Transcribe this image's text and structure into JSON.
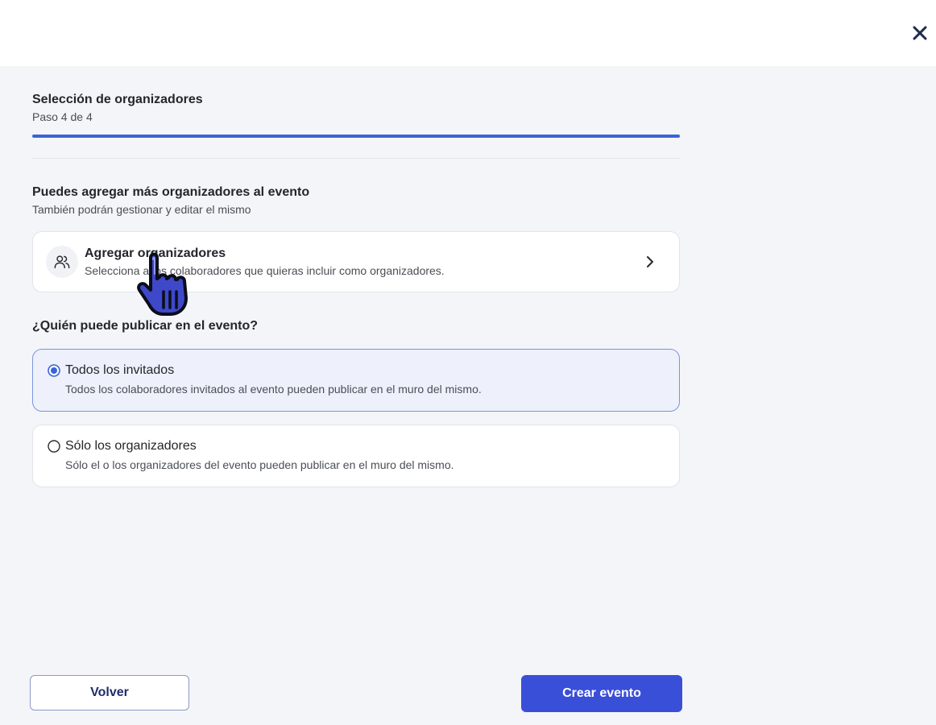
{
  "header": {
    "close_icon": "close-icon"
  },
  "step": {
    "title": "Selección de organizadores",
    "subtitle": "Paso 4 de 4",
    "current": 4,
    "total": 4,
    "progress_fraction": 1.0
  },
  "organizers": {
    "title": "Puedes agregar más organizadores al evento",
    "subtitle": "También podrán gestionar y editar el mismo",
    "card": {
      "icon": "users-icon",
      "title": "Agregar organizadores",
      "subtitle": "Selecciona a los colaboradores que quieras incluir como organizadores.",
      "chevron_icon": "chevron-right-icon"
    }
  },
  "publish": {
    "question": "¿Quién puede publicar en el evento?",
    "options": [
      {
        "title": "Todos los invitados",
        "subtitle": "Todos los colaboradores invitados al evento pueden publicar en el muro del mismo.",
        "selected": true
      },
      {
        "title": "Sólo los organizadores",
        "subtitle": "Sólo el o los organizadores del evento pueden publicar en el muro del mismo.",
        "selected": false
      }
    ]
  },
  "footer": {
    "back_label": "Volver",
    "create_label": "Crear evento"
  },
  "colors": {
    "accent": "#3b63d8",
    "primary_button": "#3a4fd8",
    "cursor": "#3e48c9"
  }
}
